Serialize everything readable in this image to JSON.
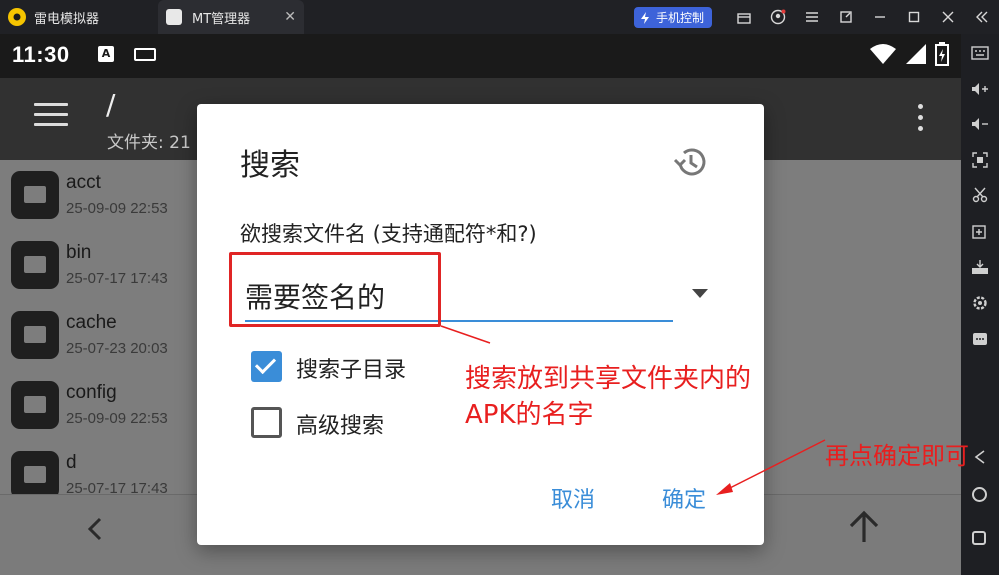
{
  "titlebar": {
    "tabs": [
      {
        "label": "雷电模拟器",
        "icon": "leidian-logo-icon"
      },
      {
        "label": "MT管理器",
        "icon": "mt-manager-icon",
        "close": "✕"
      }
    ],
    "phone_control_label": "手机控制",
    "window_icons": [
      "store-icon",
      "user-icon",
      "menu-icon",
      "external-window-icon",
      "minimize-icon",
      "maximize-icon",
      "close-icon",
      "collapse-sidebar-icon"
    ]
  },
  "statusbar": {
    "time": "11:30",
    "a_badge": "A"
  },
  "appbar": {
    "path": "/",
    "subinfo": "文件夹: 21"
  },
  "files": [
    {
      "name": "acct",
      "date": "25-09-09 22:53"
    },
    {
      "name": "bin",
      "date": "25-07-17 17:43"
    },
    {
      "name": "cache",
      "date": "25-07-23 20:03"
    },
    {
      "name": "config",
      "date": "25-09-09 22:53"
    },
    {
      "name": "d",
      "date": "25-07-17 17:43"
    }
  ],
  "dialog": {
    "title": "搜索",
    "label": "欲搜索文件名 (支持通配符*和?)",
    "input_value": "需要签名的",
    "options": [
      {
        "label": "搜索子目录",
        "checked": true
      },
      {
        "label": "高级搜索",
        "checked": false
      }
    ],
    "cancel_label": "取消",
    "confirm_label": "确定"
  },
  "annotations": {
    "note1_line1": "搜索放到共享文件夹内的",
    "note1_line2": "APK的名字",
    "note2": "再点确定即可",
    "color": "#e81f1f"
  },
  "colors": {
    "accent": "#3a8dd8",
    "phone_control_bg": "#3d63d9"
  }
}
